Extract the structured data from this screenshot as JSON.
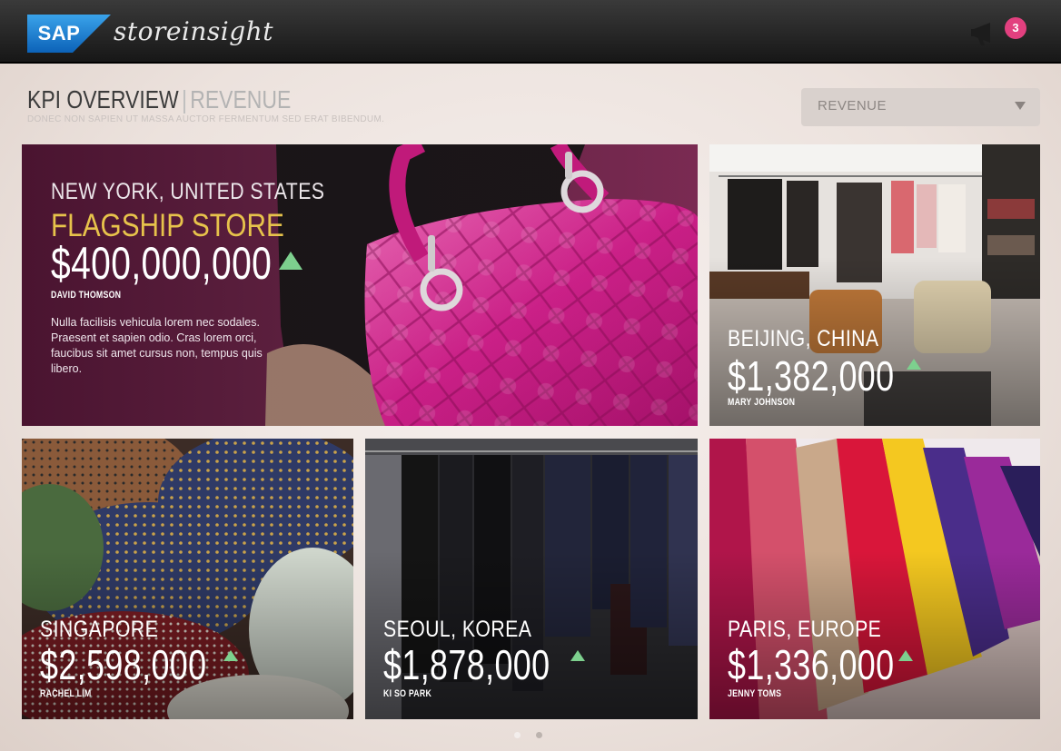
{
  "app": {
    "brand": "SAP",
    "name": "storeinsight",
    "notification_count": "3"
  },
  "header": {
    "title": "KPI OVERVIEW",
    "separator": "|",
    "section": "REVENUE",
    "subtitle": "DONEC NON SAPIEN UT MASSA AUCTOR FERMENTUM SED ERAT BIBENDUM."
  },
  "metric_select": {
    "selected": "REVENUE"
  },
  "tiles": [
    {
      "city": "NEW YORK, UNITED STATES",
      "store": "FLAGSHIP STORE",
      "amount": "$400,000,000",
      "person": "DAVID THOMSON",
      "description": "Nulla facilisis vehicula lorem nec sodales. Praesent et sapien odio. Cras lorem orci, faucibus sit amet cursus non, tempus quis libero.",
      "trend": "up"
    },
    {
      "city": "BEIJING, CHINA",
      "amount": "$1,382,000",
      "person": "MARY JOHNSON",
      "trend": "up"
    },
    {
      "city": "SINGAPORE",
      "amount": "$2,598,000",
      "person": "RACHEL LIM",
      "trend": "up"
    },
    {
      "city": "SEOUL, KOREA",
      "amount": "$1,878,000",
      "person": "KI SO PARK",
      "trend": "up"
    },
    {
      "city": "PARIS, EUROPE",
      "amount": "$1,336,000",
      "person": "JENNY TOMS",
      "trend": "up"
    }
  ],
  "pagination": {
    "pages": 2,
    "current": 1
  },
  "colors": {
    "accent_gold": "#e7c34b",
    "trend_up": "#7dd08e",
    "badge": "#e2407f",
    "sap_blue": "#1a7fd0"
  }
}
